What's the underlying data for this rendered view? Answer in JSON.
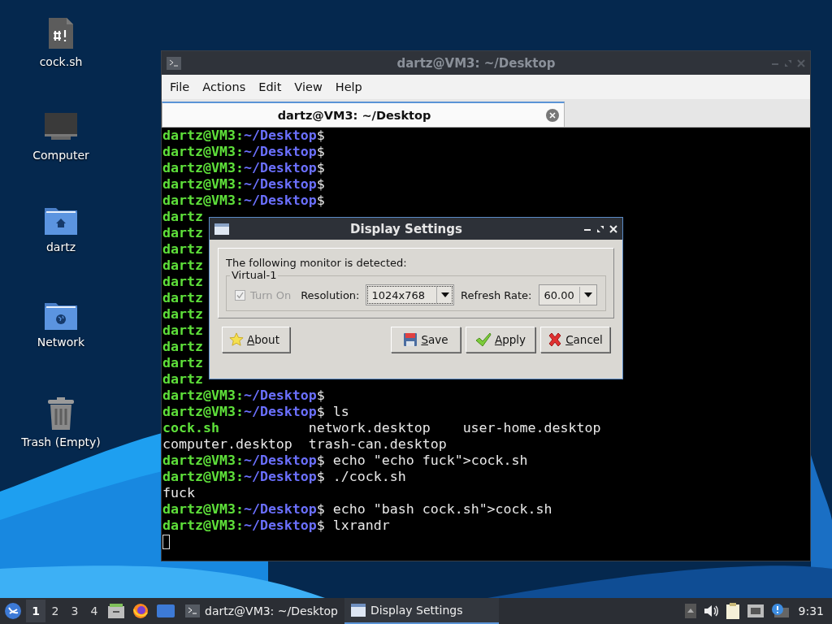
{
  "desktop_icons": [
    {
      "label": "cock.sh",
      "kind": "script"
    },
    {
      "label": "Computer",
      "kind": "computer"
    },
    {
      "label": "dartz",
      "kind": "home"
    },
    {
      "label": "Network",
      "kind": "network"
    },
    {
      "label": "Trash (Empty)",
      "kind": "trash"
    }
  ],
  "terminal": {
    "title": "dartz@VM3: ~/Desktop",
    "menu": [
      "File",
      "Actions",
      "Edit",
      "View",
      "Help"
    ],
    "tabs": [
      {
        "label": "dartz@VM3: ~/Desktop",
        "selected": true
      }
    ],
    "lines": [
      {
        "kind": "prompt",
        "user": "dartz@VM3:",
        "path": "~/Desktop",
        "command": "$"
      },
      {
        "kind": "prompt",
        "user": "dartz@VM3:",
        "path": "~/Desktop",
        "command": "$"
      },
      {
        "kind": "prompt",
        "user": "dartz@VM3:",
        "path": "~/Desktop",
        "command": "$"
      },
      {
        "kind": "prompt",
        "user": "dartz@VM3:",
        "path": "~/Desktop",
        "command": "$"
      },
      {
        "kind": "prompt",
        "user": "dartz@VM3:",
        "path": "~/Desktop",
        "command": "$"
      },
      {
        "kind": "covered",
        "text": "dartz"
      },
      {
        "kind": "covered",
        "text": "dartz"
      },
      {
        "kind": "covered",
        "text": "dartz"
      },
      {
        "kind": "covered",
        "text": "dartz"
      },
      {
        "kind": "covered",
        "text": "dartz"
      },
      {
        "kind": "covered",
        "text": "dartz"
      },
      {
        "kind": "covered",
        "text": "dartz"
      },
      {
        "kind": "covered",
        "text": "dartz"
      },
      {
        "kind": "covered",
        "text": "dartz"
      },
      {
        "kind": "covered",
        "text": "dartz"
      },
      {
        "kind": "covered",
        "text": "dartz"
      },
      {
        "kind": "prompt",
        "user": "dartz@VM3:",
        "path": "~/Desktop",
        "command": "$"
      },
      {
        "kind": "prompt",
        "user": "dartz@VM3:",
        "path": "~/Desktop",
        "command": "$ ls"
      },
      {
        "kind": "output",
        "cells": [
          {
            "text": "cock.sh",
            "kind": "exec"
          },
          {
            "text": "network.desktop",
            "kind": "file"
          },
          {
            "text": "user-home.desktop",
            "kind": "file"
          }
        ]
      },
      {
        "kind": "output",
        "cells": [
          {
            "text": "computer.desktop",
            "kind": "file"
          },
          {
            "text": "trash-can.desktop",
            "kind": "file"
          }
        ]
      },
      {
        "kind": "prompt",
        "user": "dartz@VM3:",
        "path": "~/Desktop",
        "command": "$ echo \"echo fuck\">cock.sh"
      },
      {
        "kind": "prompt",
        "user": "dartz@VM3:",
        "path": "~/Desktop",
        "command": "$ ./cock.sh"
      },
      {
        "kind": "output",
        "cells": [
          {
            "text": "fuck",
            "kind": "plain"
          }
        ]
      },
      {
        "kind": "prompt",
        "user": "dartz@VM3:",
        "path": "~/Desktop",
        "command": "$ echo \"bash cock.sh\">cock.sh"
      },
      {
        "kind": "prompt",
        "user": "dartz@VM3:",
        "path": "~/Desktop",
        "command": "$ lxrandr"
      },
      {
        "kind": "cursor"
      }
    ]
  },
  "dialog": {
    "title": "Display Settings",
    "message": "The following monitor is detected:",
    "group": "Virtual-1",
    "turn_on": {
      "label": "Turn On",
      "checked": true,
      "disabled": true
    },
    "resolution": {
      "label": "Resolution:",
      "value": "1024x768"
    },
    "refresh": {
      "label": "Refresh Rate:",
      "value": "60.00"
    },
    "buttons": [
      {
        "label": "About",
        "kind": "about"
      },
      {
        "label": "Save",
        "kind": "save"
      },
      {
        "label": "Apply",
        "kind": "apply"
      },
      {
        "label": "Cancel",
        "kind": "cancel"
      }
    ]
  },
  "taskbar": {
    "workspaces": [
      {
        "label": "1",
        "selected": true
      },
      {
        "label": "2",
        "selected": false
      },
      {
        "label": "3",
        "selected": false
      },
      {
        "label": "4",
        "selected": false
      }
    ],
    "tasks": [
      {
        "label": "dartz@VM3: ~/Desktop",
        "kind": "terminal",
        "selected": false
      },
      {
        "label": "Display Settings",
        "kind": "window",
        "selected": true
      }
    ],
    "clock": "9:31"
  }
}
